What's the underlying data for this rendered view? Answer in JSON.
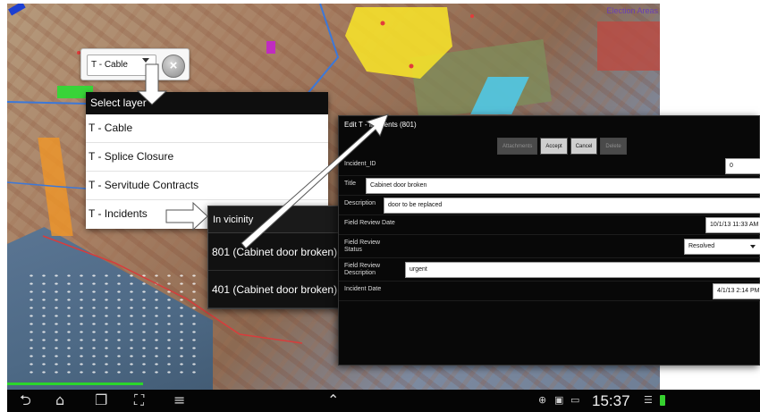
{
  "map": {
    "caption": "Election Areas"
  },
  "layer_dropdown": {
    "selected": "T - Cable",
    "close_symbol": "×"
  },
  "select_layer": {
    "title": "Select layer",
    "items": [
      {
        "label": "T - Cable"
      },
      {
        "label": "T - Splice Closure"
      },
      {
        "label": "T - Servitude Contracts"
      },
      {
        "label": "T - Incidents"
      }
    ]
  },
  "vicinity": {
    "title": "In vicinity",
    "items": [
      {
        "label": "801 (Cabinet door broken)"
      },
      {
        "label": "401 (Cabinet door broken)"
      }
    ]
  },
  "edit_panel": {
    "title": "Edit T - Incidents (801)",
    "toolbar": {
      "attachments": "Attachments",
      "accept": "Accept",
      "cancel": "Cancel",
      "delete": "Delete"
    },
    "fields": {
      "incident_id": {
        "label": "Incident_ID",
        "value": "0"
      },
      "title": {
        "label": "Title",
        "value": "Cabinet door broken"
      },
      "description": {
        "label": "Description",
        "value": "door to be replaced"
      },
      "field_review_date": {
        "label": "Field Review Date",
        "value": "10/1/13 11:33 AM"
      },
      "field_review_status": {
        "label": "Field Review Status",
        "value": "Resolved"
      },
      "field_review_description": {
        "label": "Field Review Description",
        "value": "urgent"
      },
      "incident_date": {
        "label": "Incident Date",
        "value": "4/1/13 2:14 PM"
      }
    }
  },
  "status_bar": {
    "time": "15:37",
    "icons": [
      "back-icon",
      "home-icon",
      "recent-apps-icon",
      "screenshot-icon",
      "menu-icon",
      "up-chevron-icon",
      "gps-icon",
      "gallery-icon",
      "message-icon",
      "wifi-icon",
      "battery-icon"
    ]
  },
  "colors": {
    "selection_yellow": "#fae628",
    "cable_blue": "#3c78d8",
    "progress_green": "#2bd62b",
    "panel_black": "#080808"
  }
}
